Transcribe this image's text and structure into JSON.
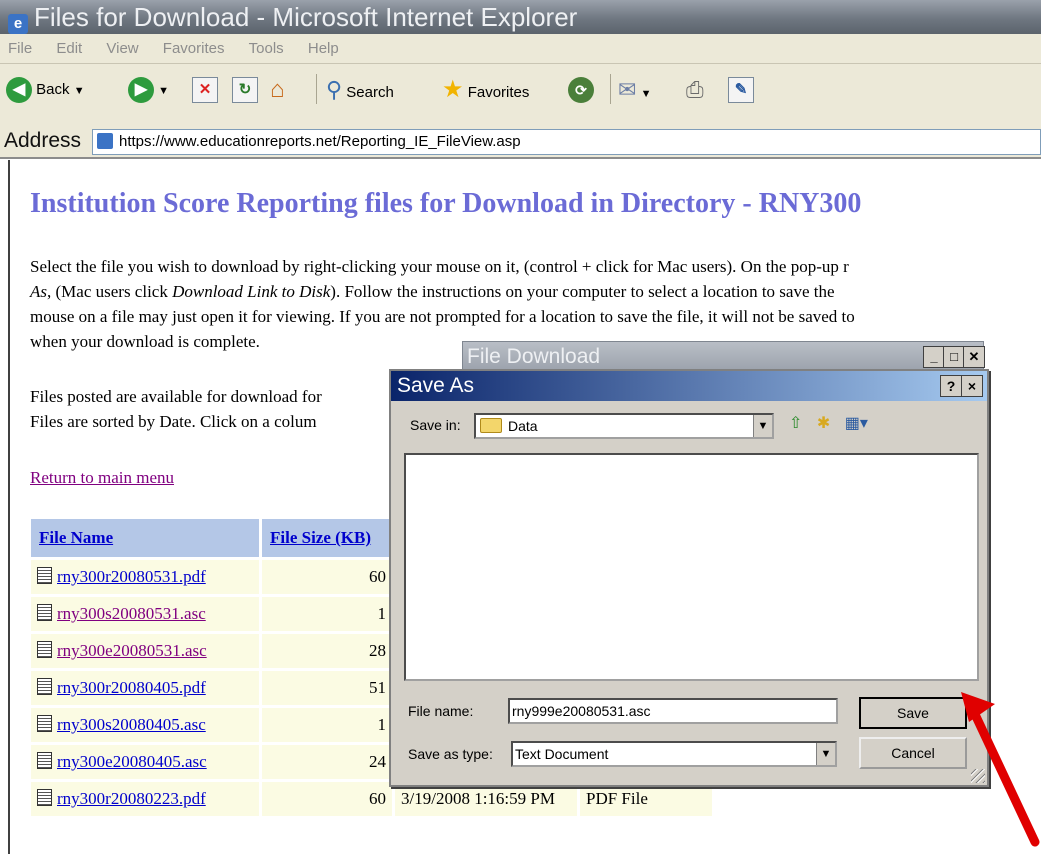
{
  "window": {
    "title": "Files for Download - Microsoft Internet Explorer",
    "menu": [
      "File",
      "Edit",
      "View",
      "Favorites",
      "Tools",
      "Help"
    ],
    "toolbar": {
      "back_label": "Back",
      "search_label": "Search",
      "favorites_label": "Favorites"
    },
    "address_label": "Address",
    "address_url": "https://www.educationreports.net/Reporting_IE_FileView.asp"
  },
  "page": {
    "heading": "Institution Score Reporting files for Download in Directory - RNY300",
    "instructions": {
      "line1": "Select the file you wish to download by right-clicking your mouse on it, (control + click for Mac users). On the pop-up r",
      "line2_em1": "As",
      "line2_mid": ", (Mac users click ",
      "line2_em2": "Download Link to Disk",
      "line2_end": "). Follow the instructions on your computer to select a location to save the",
      "line3": "mouse on a file may just open it for viewing. If you are not prompted for a location to save the file, it will not be saved to",
      "line4": "when your download is complete."
    },
    "posted_line": "Files posted are available for download for",
    "sorted_line": "Files are sorted by Date. Click on a colum",
    "return_link": "Return to main menu",
    "table": {
      "headers": [
        "File Name",
        "File Size (KB)"
      ],
      "rows": [
        {
          "name": "rny300r20080531.pdf",
          "size": "60",
          "date": "",
          "type": "",
          "visited": false
        },
        {
          "name": "rny300s20080531.asc",
          "size": "1",
          "date": "",
          "type": "",
          "visited": true
        },
        {
          "name": "rny300e20080531.asc",
          "size": "28",
          "date": "",
          "type": "",
          "visited": true
        },
        {
          "name": "rny300r20080405.pdf",
          "size": "51",
          "date": "",
          "type": "",
          "visited": false
        },
        {
          "name": "rny300s20080405.asc",
          "size": "1",
          "date": "",
          "type": "",
          "visited": false
        },
        {
          "name": "rny300e20080405.asc",
          "size": "24",
          "date": "",
          "type": "",
          "visited": false
        },
        {
          "name": "rny300r20080223.pdf",
          "size": "60",
          "date": "3/19/2008 1:16:59 PM",
          "type": "PDF File",
          "visited": false
        }
      ]
    }
  },
  "file_download_dialog": {
    "title": "File Download"
  },
  "save_as_dialog": {
    "title": "Save As",
    "save_in_label": "Save in:",
    "save_in_value": "Data",
    "file_name_label": "File name:",
    "file_name_value": "rny999e20080531.asc",
    "save_as_type_label": "Save as type:",
    "save_as_type_value": "Text Document",
    "save_button": "Save",
    "cancel_button": "Cancel",
    "help_button": "?",
    "close_button": "×"
  },
  "colors": {
    "heading": "#6b6bd6",
    "link": "#0000cc",
    "visited_link": "#800080",
    "table_header_bg": "#b4c7e7",
    "table_cell_bg": "#fbfbe3",
    "annotation_arrow": "#e00000"
  }
}
